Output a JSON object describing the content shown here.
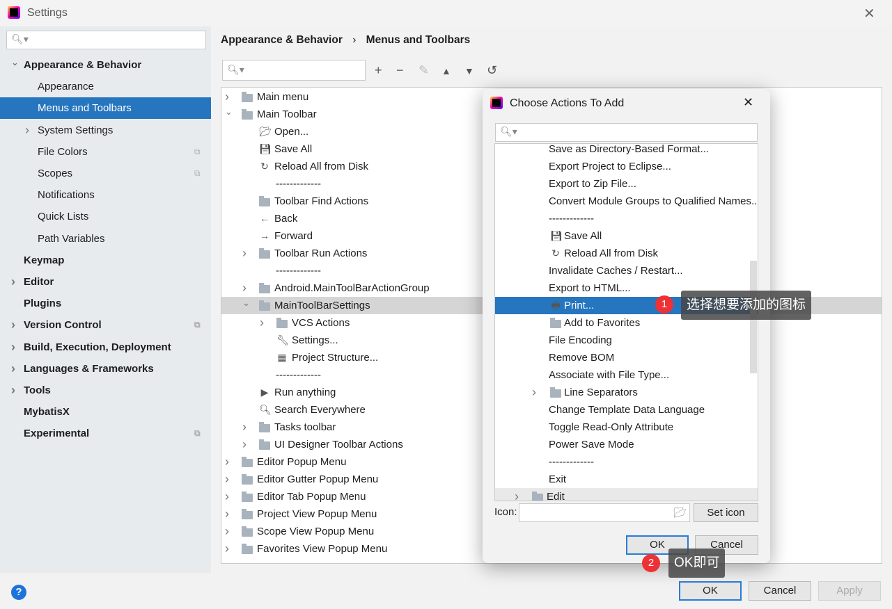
{
  "window": {
    "title": "Settings"
  },
  "sidebar": {
    "items": [
      {
        "label": "Appearance & Behavior",
        "level": 0,
        "bold": true,
        "chevron": "down"
      },
      {
        "label": "Appearance",
        "level": 1
      },
      {
        "label": "Menus and Toolbars",
        "level": 1,
        "selected": true
      },
      {
        "label": "System Settings",
        "level": 1,
        "chevron": "right"
      },
      {
        "label": "File Colors",
        "level": 1,
        "copy": true
      },
      {
        "label": "Scopes",
        "level": 1,
        "copy": true
      },
      {
        "label": "Notifications",
        "level": 1
      },
      {
        "label": "Quick Lists",
        "level": 1
      },
      {
        "label": "Path Variables",
        "level": 1
      },
      {
        "label": "Keymap",
        "level": 0,
        "bold": true
      },
      {
        "label": "Editor",
        "level": 0,
        "bold": true,
        "chevron": "right"
      },
      {
        "label": "Plugins",
        "level": 0,
        "bold": true
      },
      {
        "label": "Version Control",
        "level": 0,
        "bold": true,
        "chevron": "right",
        "copy": true
      },
      {
        "label": "Build, Execution, Deployment",
        "level": 0,
        "bold": true,
        "chevron": "right"
      },
      {
        "label": "Languages & Frameworks",
        "level": 0,
        "bold": true,
        "chevron": "right"
      },
      {
        "label": "Tools",
        "level": 0,
        "bold": true,
        "chevron": "right"
      },
      {
        "label": "MybatisX",
        "level": 0,
        "bold": true
      },
      {
        "label": "Experimental",
        "level": 0,
        "bold": true,
        "copy": true
      }
    ]
  },
  "breadcrumb": {
    "parent": "Appearance & Behavior",
    "current": "Menus and Toolbars"
  },
  "toolbar": [
    "add-icon",
    "remove-icon",
    "edit-icon",
    "move-up-icon",
    "move-down-icon",
    "restore-icon"
  ],
  "tree": [
    {
      "label": "Main menu",
      "level": 0,
      "chevron": "right",
      "icon": "folder"
    },
    {
      "label": "Main Toolbar",
      "level": 0,
      "chevron": "down",
      "icon": "folder"
    },
    {
      "label": "Open...",
      "level": 1,
      "icon": "open"
    },
    {
      "label": "Save All",
      "level": 1,
      "icon": "save"
    },
    {
      "label": "Reload All from Disk",
      "level": 1,
      "icon": "reload"
    },
    {
      "label": "-------------",
      "level": 1
    },
    {
      "label": "Toolbar Find Actions",
      "level": 1,
      "icon": "folder"
    },
    {
      "label": "Back",
      "level": 1,
      "icon": "back"
    },
    {
      "label": "Forward",
      "level": 1,
      "icon": "forward"
    },
    {
      "label": "Toolbar Run Actions",
      "level": 1,
      "chevron": "right",
      "icon": "folder"
    },
    {
      "label": "-------------",
      "level": 1
    },
    {
      "label": "Android.MainToolBarActionGroup",
      "level": 1,
      "chevron": "right",
      "icon": "folder"
    },
    {
      "label": "MainToolBarSettings",
      "level": 1,
      "chevron": "down",
      "icon": "folder",
      "highlight": true
    },
    {
      "label": "VCS Actions",
      "level": 2,
      "chevron": "right",
      "icon": "folder"
    },
    {
      "label": "Settings...",
      "level": 2,
      "icon": "wrench"
    },
    {
      "label": "Project Structure...",
      "level": 2,
      "icon": "structure"
    },
    {
      "label": "-------------",
      "level": 1
    },
    {
      "label": "Run anything",
      "level": 1,
      "icon": "run"
    },
    {
      "label": "Search Everywhere",
      "level": 1,
      "icon": "search"
    },
    {
      "label": "Tasks toolbar",
      "level": 1,
      "chevron": "right",
      "icon": "folder"
    },
    {
      "label": "UI Designer Toolbar Actions",
      "level": 1,
      "chevron": "right",
      "icon": "folder"
    },
    {
      "label": "Editor Popup Menu",
      "level": 0,
      "chevron": "right",
      "icon": "folder"
    },
    {
      "label": "Editor Gutter Popup Menu",
      "level": 0,
      "chevron": "right",
      "icon": "folder"
    },
    {
      "label": "Editor Tab Popup Menu",
      "level": 0,
      "chevron": "right",
      "icon": "folder"
    },
    {
      "label": "Project View Popup Menu",
      "level": 0,
      "chevron": "right",
      "icon": "folder"
    },
    {
      "label": "Scope View Popup Menu",
      "level": 0,
      "chevron": "right",
      "icon": "folder"
    },
    {
      "label": "Favorites View Popup Menu",
      "level": 0,
      "chevron": "right",
      "icon": "folder"
    }
  ],
  "dialog": {
    "title": "Choose Actions To Add",
    "items": [
      {
        "label": "Save as Directory-Based Format..."
      },
      {
        "label": "Export Project to Eclipse..."
      },
      {
        "label": "Export to Zip File..."
      },
      {
        "label": "Convert Module Groups to Qualified Names..."
      },
      {
        "label": "-------------"
      },
      {
        "label": "Save All",
        "icon": "save"
      },
      {
        "label": "Reload All from Disk",
        "icon": "reload"
      },
      {
        "label": "Invalidate Caches / Restart..."
      },
      {
        "label": "Export to HTML..."
      },
      {
        "label": "Print...",
        "icon": "print",
        "selected": true
      },
      {
        "label": "Add to Favorites",
        "icon": "folder"
      },
      {
        "label": "File Encoding"
      },
      {
        "label": "Remove BOM"
      },
      {
        "label": "Associate with File Type..."
      },
      {
        "label": "Line Separators",
        "icon": "folder",
        "chevron": "right"
      },
      {
        "label": "Change Template Data Language"
      },
      {
        "label": "Toggle Read-Only Attribute"
      },
      {
        "label": "Power Save Mode"
      },
      {
        "label": "-------------"
      },
      {
        "label": "Exit"
      },
      {
        "label": "Edit",
        "icon": "folder",
        "chevron": "right",
        "top": true
      }
    ],
    "icon_label": "Icon:",
    "icon_value": "",
    "set_icon": "Set icon",
    "ok": "OK",
    "cancel": "Cancel"
  },
  "annotations": [
    {
      "number": "1",
      "text": "选择想要添加的图标"
    },
    {
      "number": "2",
      "text": "OK即可"
    }
  ],
  "footer": {
    "ok": "OK",
    "cancel": "Cancel",
    "apply": "Apply",
    "help": "?"
  },
  "colors": {
    "selection": "#2675bf",
    "badge": "#ee3135"
  }
}
